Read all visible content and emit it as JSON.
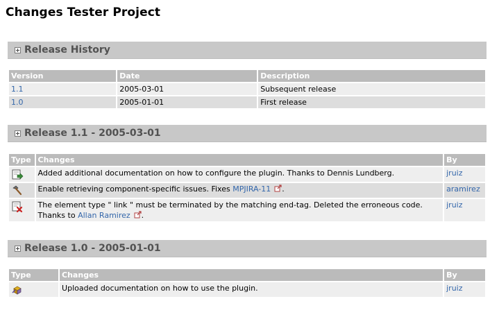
{
  "page": {
    "title": "Changes Tester Project"
  },
  "colors": {
    "header_bar": "#c8c8c8",
    "table_header": "#bbbbbb",
    "row_light": "#eeeeee",
    "row_dark": "#dddddd",
    "link": "#3366aa",
    "section_title": "#525252"
  },
  "release_history": {
    "title": "Release History",
    "columns": [
      "Version",
      "Date",
      "Description"
    ],
    "rows": [
      {
        "version": "1.1",
        "date": "2005-03-01",
        "description": "Subsequent release"
      },
      {
        "version": "1.0",
        "date": "2005-01-01",
        "description": "First release"
      }
    ]
  },
  "release_11": {
    "title": "Release 1.1 - 2005-03-01",
    "columns": [
      "Type",
      "Changes",
      "By"
    ],
    "rows": [
      {
        "type_icon": "add-icon",
        "change": "Added additional documentation on how to configure the plugin. Thanks to Dennis Lundberg.",
        "by": "jruiz"
      },
      {
        "type_icon": "fix-icon",
        "change_prefix": "Enable retrieving component-specific issues. Fixes ",
        "issue_link": "MPJIRA-11",
        "change_suffix": ".",
        "by": "aramirez"
      },
      {
        "type_icon": "remove-icon",
        "change_prefix": "The element type \" link \" must be terminated by the matching end-tag. Deleted the erroneous code. Thanks to ",
        "thanks_link": "Allan Ramirez",
        "change_suffix": ".",
        "by": "jruiz"
      }
    ]
  },
  "release_10": {
    "title": "Release 1.0 - 2005-01-01",
    "columns": [
      "Type",
      "Changes",
      "By"
    ],
    "rows": [
      {
        "type_icon": "update-icon",
        "change": "Uploaded documentation on how to use the plugin.",
        "by": "jruiz"
      }
    ]
  }
}
